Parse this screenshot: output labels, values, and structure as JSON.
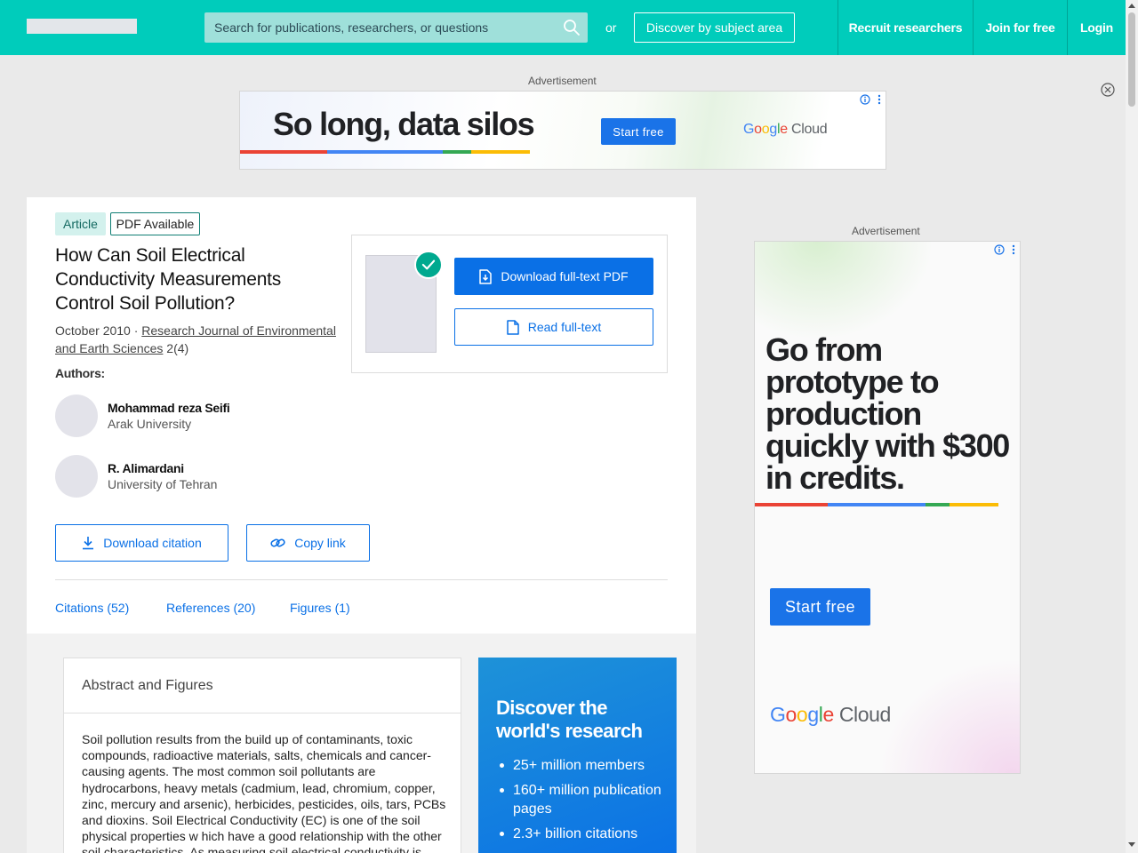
{
  "header": {
    "search_placeholder": "Search for publications, researchers, or questions",
    "or_text": "or",
    "discover_label": "Discover by subject area",
    "nav": {
      "recruit": "Recruit researchers",
      "join": "Join for free",
      "login": "Login"
    }
  },
  "ads": {
    "label": "Advertisement",
    "top": {
      "headline": "So long, data silos",
      "button": "Start free",
      "brand": "Google",
      "brand_suffix": "Cloud"
    },
    "side": {
      "headline": "Go from prototype to production quickly with $300 in credits.",
      "button": "Start free",
      "brand": "Google",
      "brand_suffix": "Cloud"
    }
  },
  "publication": {
    "type_badge": "Article",
    "pdf_badge": "PDF Available",
    "title": "How Can Soil Electrical Conductivity Measurements Control Soil Pollution?",
    "date": "October 2010 · ",
    "journal": "Research Journal of Environmental and Earth Sciences",
    "issue": " 2(4)",
    "authors_label": "Authors:",
    "authors": [
      {
        "name": "Mohammad reza Seifi",
        "institution": "Arak University"
      },
      {
        "name": "R. Alimardani",
        "institution": "University of Tehran"
      }
    ],
    "download_pdf": "Download full-text PDF",
    "read_fulltext": "Read full-text",
    "download_citation": "Download citation",
    "copy_link": "Copy link",
    "tabs": [
      "Citations (52)",
      "References (20)",
      "Figures (1)"
    ]
  },
  "abstract": {
    "heading": "Abstract and Figures",
    "text": "Soil pollution results from the build up of contaminants, toxic compounds, radioactive materials, salts, chemicals and cancer-causing agents. The most common soil pollutants are hydrocarbons, heavy metals (cadmium, lead, chromium, copper, zinc, mercury and arsenic), herbicides, pesticides, oils, tars, PCBs and dioxins. Soil Electrical Conductivity (EC) is one of the soil physical properties w hich have a good relationship with the other soil characteristics. As measuring soil electrical conductivity is"
  },
  "promo": {
    "title": "Discover the world's research",
    "items": [
      "25+ million members",
      "160+ million publication pages",
      "2.3+ billion citations"
    ]
  },
  "colors": {
    "header_bg": "#00ccbb",
    "primary_blue": "#0a70e6",
    "google_red": "#ea4335",
    "google_blue": "#4285f4",
    "google_green": "#34a853",
    "google_yellow": "#fbbc05"
  }
}
